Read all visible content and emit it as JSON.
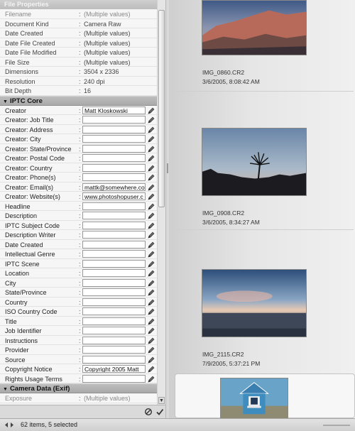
{
  "panel_title": "File Properties",
  "file_properties": [
    {
      "label": "Filename",
      "value": "(Multiple values)"
    },
    {
      "label": "Document Kind",
      "value": "Camera Raw"
    },
    {
      "label": "Date Created",
      "value": "(Multiple values)"
    },
    {
      "label": "Date File Created",
      "value": "(Multiple values)"
    },
    {
      "label": "Date File Modified",
      "value": "(Multiple values)"
    },
    {
      "label": "File Size",
      "value": "(Multiple values)"
    },
    {
      "label": "Dimensions",
      "value": "3504 x 2336"
    },
    {
      "label": "Resolution",
      "value": "240 dpi"
    },
    {
      "label": "Bit Depth",
      "value": "16"
    }
  ],
  "iptc_title": "IPTC Core",
  "iptc_fields": [
    {
      "label": "Creator",
      "value": "Matt Kloskowski"
    },
    {
      "label": "Creator: Job Title",
      "value": ""
    },
    {
      "label": "Creator: Address",
      "value": ""
    },
    {
      "label": "Creator: City",
      "value": ""
    },
    {
      "label": "Creator: State/Province",
      "value": ""
    },
    {
      "label": "Creator: Postal Code",
      "value": ""
    },
    {
      "label": "Creator: Country",
      "value": ""
    },
    {
      "label": "Creator: Phone(s)",
      "value": ""
    },
    {
      "label": "Creator: Email(s)",
      "value": "mattk@somewhere.co"
    },
    {
      "label": "Creator: Website(s)",
      "value": "www.photoshopuser.c"
    },
    {
      "label": "Headline",
      "value": ""
    },
    {
      "label": "Description",
      "value": ""
    },
    {
      "label": "IPTC Subject Code",
      "value": ""
    },
    {
      "label": "Description Writer",
      "value": ""
    },
    {
      "label": "Date Created",
      "value": ""
    },
    {
      "label": "Intellectual Genre",
      "value": ""
    },
    {
      "label": "IPTC Scene",
      "value": ""
    },
    {
      "label": "Location",
      "value": ""
    },
    {
      "label": "City",
      "value": ""
    },
    {
      "label": "State/Province",
      "value": ""
    },
    {
      "label": "Country",
      "value": ""
    },
    {
      "label": "ISO Country Code",
      "value": ""
    },
    {
      "label": "Title",
      "value": ""
    },
    {
      "label": "Job Identifier",
      "value": ""
    },
    {
      "label": "Instructions",
      "value": ""
    },
    {
      "label": "Provider",
      "value": ""
    },
    {
      "label": "Source",
      "value": ""
    },
    {
      "label": "Copyright Notice",
      "value": "Copyright 2005 Matt"
    },
    {
      "label": "Rights Usage Terms",
      "value": ""
    }
  ],
  "exif_title": "Camera Data (Exif)",
  "exif_rows": [
    {
      "label": "Exposure",
      "value": "(Multiple values)"
    }
  ],
  "thumbnails": [
    {
      "filename": "IMG_0860.CR2",
      "date": "3/6/2005, 8:08:42 AM",
      "palette": "desert"
    },
    {
      "filename": "IMG_0908.CR2",
      "date": "3/6/2005, 8:34:27 AM",
      "palette": "silhouette"
    },
    {
      "filename": "IMG_2115.CR2",
      "date": "7/9/2005, 5:37:21 PM",
      "palette": "sunset-sea"
    },
    {
      "filename": "",
      "date": "",
      "palette": "house"
    }
  ],
  "status_text": "62 items, 5 selected",
  "colors": {
    "section_bg": "#b3b3b3",
    "field_border": "#9a9a9a",
    "panel_bg": "#f2f2f2"
  }
}
